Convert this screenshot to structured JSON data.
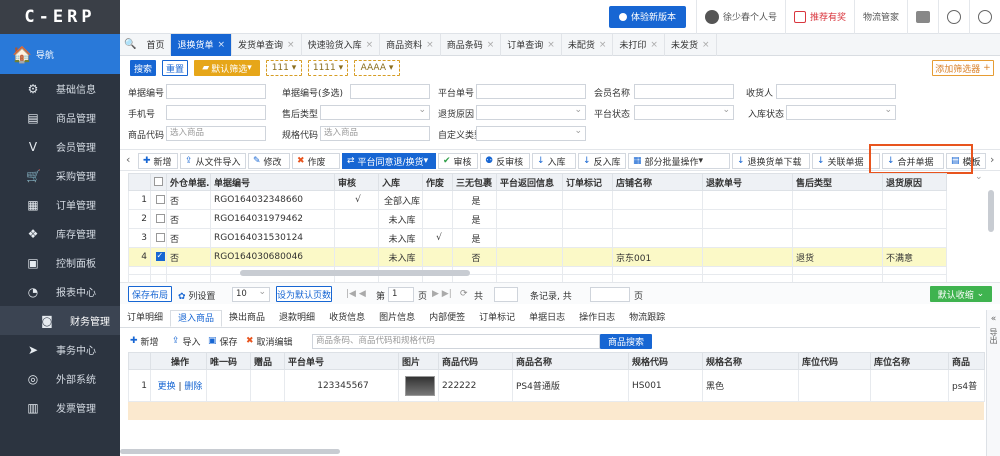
{
  "app": {
    "logo": "C-ERP",
    "nav_label": "导航"
  },
  "sidebar": [
    {
      "label": "基础信息",
      "icon": "gear-icon",
      "glyph": "⚙"
    },
    {
      "label": "商品管理",
      "icon": "box-icon",
      "glyph": "▤"
    },
    {
      "label": "会员管理",
      "icon": "v-icon",
      "glyph": "V"
    },
    {
      "label": "采购管理",
      "icon": "cart-icon",
      "glyph": "🛒"
    },
    {
      "label": "订单管理",
      "icon": "doc-icon",
      "glyph": "▦"
    },
    {
      "label": "库存管理",
      "icon": "stock-icon",
      "glyph": "❖"
    },
    {
      "label": "控制面板",
      "icon": "grid-icon",
      "glyph": "▣"
    },
    {
      "label": "报表中心",
      "icon": "pie-icon",
      "glyph": "◔"
    },
    {
      "label": "财务管理",
      "icon": "finance-icon",
      "glyph": "◙"
    },
    {
      "label": "事务中心",
      "icon": "send-icon",
      "glyph": "➤"
    },
    {
      "label": "外部系统",
      "icon": "compass-icon",
      "glyph": "◎"
    },
    {
      "label": "发票管理",
      "icon": "invoice-icon",
      "glyph": "▥"
    }
  ],
  "topbar": {
    "new_version": "体验新版本",
    "user": "徐少春个人号",
    "reward": "推荐有奖",
    "manager": "物流管家"
  },
  "tabs": [
    "首页",
    "退换货单",
    "发货单查询",
    "快速验货入库",
    "商品资料",
    "商品条码",
    "订单查询",
    "未配货",
    "未打印",
    "未发货"
  ],
  "active_tab": 1,
  "filter": {
    "search": "搜索",
    "reset": "重置",
    "default_filter": "默认筛选",
    "tags": [
      "111",
      "1111",
      "AAAA"
    ],
    "add_filter": "添加筛选器",
    "labels": {
      "order_no": "单据编号",
      "order_no_multi": "单据编号(多选)",
      "platform_no": "平台单号",
      "member": "会员名称",
      "receiver": "收货人",
      "phone": "手机号",
      "after_type": "售后类型",
      "return_reason": "退货原因",
      "platform_status": "平台状态",
      "instock_status": "入库状态",
      "product_code": "商品代码",
      "spec_code": "规格代码",
      "custom_type": "自定义类型"
    },
    "placeholders": {
      "product": "选入商品"
    }
  },
  "toolbar": [
    "新增",
    "从文件导入",
    "修改",
    "作废",
    "平台同意退/换货",
    "审核",
    "反审核",
    "入库",
    "反入库",
    "部分批量操作",
    "退换货单下载",
    "关联单据",
    "合并单据",
    "模板"
  ],
  "grid": {
    "headers": [
      "",
      "",
      "外仓单据..",
      "单据编号",
      "审核",
      "入库",
      "作废",
      "三无包裹",
      "平台返回信息",
      "订单标记",
      "店铺名称",
      "退款单号",
      "售后类型",
      "退货原因"
    ],
    "rows": [
      {
        "n": "1",
        "c": false,
        "ext": "否",
        "no": "RGO164032348660",
        "audit": "√",
        "instock": "全部入库",
        "void": "",
        "three": "是",
        "shop": "",
        "type": "",
        "reason": ""
      },
      {
        "n": "2",
        "c": false,
        "ext": "否",
        "no": "RGO164031979462",
        "audit": "",
        "instock": "未入库",
        "void": "",
        "three": "是",
        "shop": "",
        "type": "",
        "reason": ""
      },
      {
        "n": "3",
        "c": false,
        "ext": "否",
        "no": "RGO164031530124",
        "audit": "",
        "instock": "未入库",
        "void": "√",
        "three": "是",
        "shop": "",
        "type": "",
        "reason": ""
      },
      {
        "n": "4",
        "c": true,
        "ext": "否",
        "no": "RGO164030680046",
        "audit": "",
        "instock": "未入库",
        "void": "",
        "three": "否",
        "shop": "京东001",
        "type": "退货",
        "reason": "不满意"
      }
    ]
  },
  "pager": {
    "save_layout": "保存布局",
    "col_settings": "列设置",
    "page_size": "10",
    "set_default": "设为默认页数",
    "page_prefix": "第",
    "page": "1",
    "page_suffix": "页",
    "total_prefix": "共",
    "records": "条记录, 共",
    "pages_suffix": "页",
    "default_collapse": "默认收缩"
  },
  "bottom_tabs": [
    "订单明细",
    "退入商品",
    "换出商品",
    "退款明细",
    "收货信息",
    "图片信息",
    "内部便签",
    "订单标记",
    "单据日志",
    "操作日志",
    "物流跟踪"
  ],
  "bottom_active": 1,
  "btoolbar": {
    "add": "新增",
    "import": "导入",
    "save": "保存",
    "cancel": "取消编辑",
    "search_placeholder": "商品条码、商品代码和规格代码",
    "search_btn": "商品搜索"
  },
  "bgrid": {
    "headers": [
      "",
      "操作",
      "唯一码",
      "赠品",
      "平台单号",
      "图片",
      "商品代码",
      "商品名称",
      "规格代码",
      "规格名称",
      "库位代码",
      "库位名称",
      "商品"
    ],
    "row": {
      "n": "1",
      "op_a": "更换",
      "op_sep": "|",
      "op_b": "删除",
      "platform": "123345567",
      "code": "222222",
      "name": "PS4普通版",
      "spec": "HS001",
      "spec_name": "黑色",
      "tail": "ps4普"
    }
  },
  "side_handle": "导出"
}
